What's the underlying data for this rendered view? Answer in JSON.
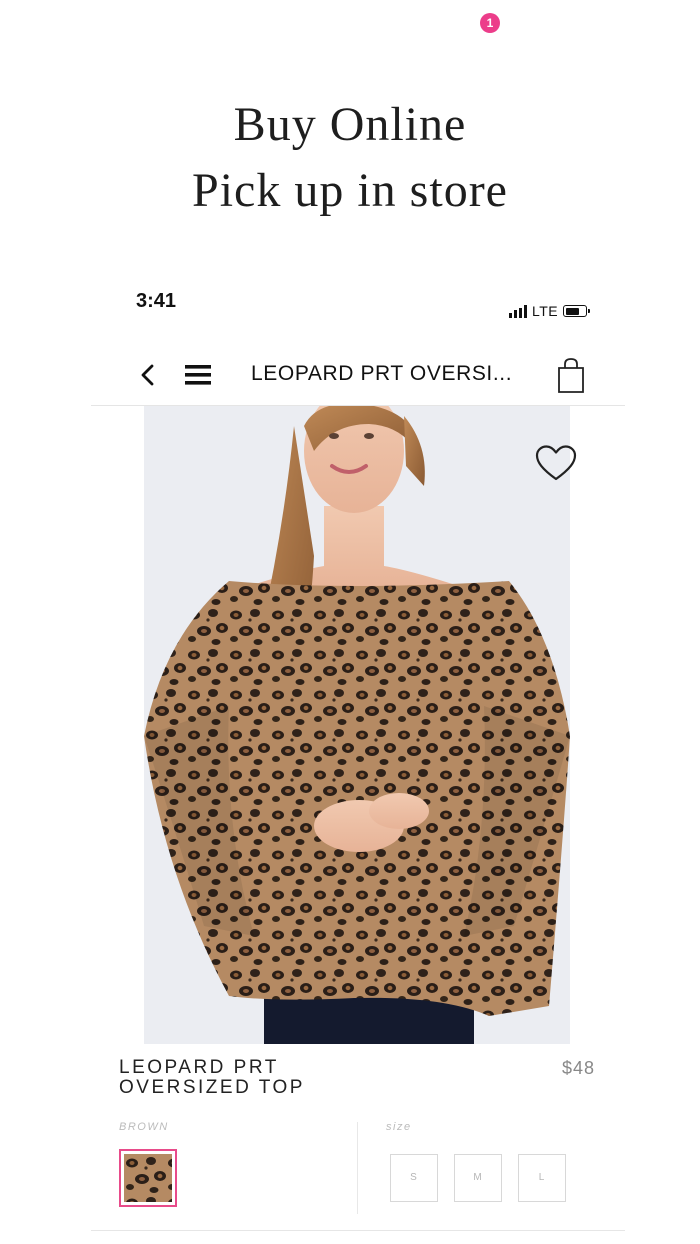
{
  "promo": {
    "line1": "Buy Online",
    "line2": "Pick up in store"
  },
  "status_bar": {
    "time": "3:41",
    "network": "LTE",
    "signal_icon": "signal-bars-icon",
    "battery_icon": "battery-icon"
  },
  "nav": {
    "back_icon": "chevron-left-icon",
    "menu_icon": "hamburger-menu-icon",
    "title": "LEOPARD PRT OVERSI...",
    "cart_icon": "shopping-bag-icon",
    "cart_count": "1",
    "badge_color": "#ec3d8a"
  },
  "product": {
    "image": "leopard-print-off-shoulder-top-photo",
    "favorite_icon": "heart-outline-icon",
    "name_line1": "LEOPARD PRT",
    "name_line2": "OVERSIZED TOP",
    "price": "$48"
  },
  "options": {
    "color_label": "BROWN",
    "selected_color_swatch": "leopard-swatch",
    "swatch_border_color": "#e84b8a",
    "size_label": "size",
    "sizes": [
      "S",
      "M",
      "L"
    ]
  }
}
